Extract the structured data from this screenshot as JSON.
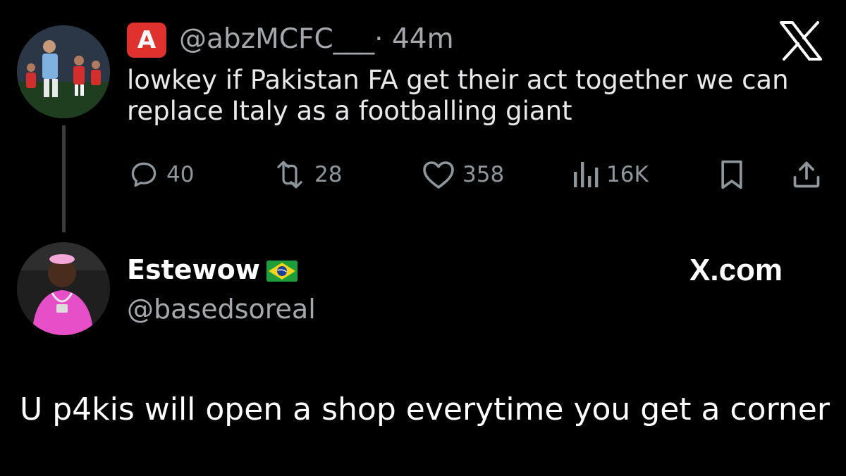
{
  "tweet": {
    "badge_letter": "A",
    "handle": "@abzMCFC___",
    "time": "· 44m",
    "text": "lowkey if Pakistan FA get their act together we can replace Italy as a footballing giant",
    "actions": {
      "replies": "40",
      "retweets": "28",
      "likes": "358",
      "views": "16K"
    },
    "badge_color": "#e0322c"
  },
  "reply": {
    "display_name": "Estewow",
    "handle": "@basedsoreal",
    "text": "U p4kis will open a shop everytime you get a corner"
  },
  "brand": {
    "site": "X.com"
  },
  "icons": {
    "x_logo": "x-logo-icon",
    "reply": "reply-icon",
    "retweet": "retweet-icon",
    "like": "heart-icon",
    "views": "views-icon",
    "bookmark": "bookmark-icon",
    "share": "share-icon",
    "flag": "brazil-flag-icon"
  }
}
